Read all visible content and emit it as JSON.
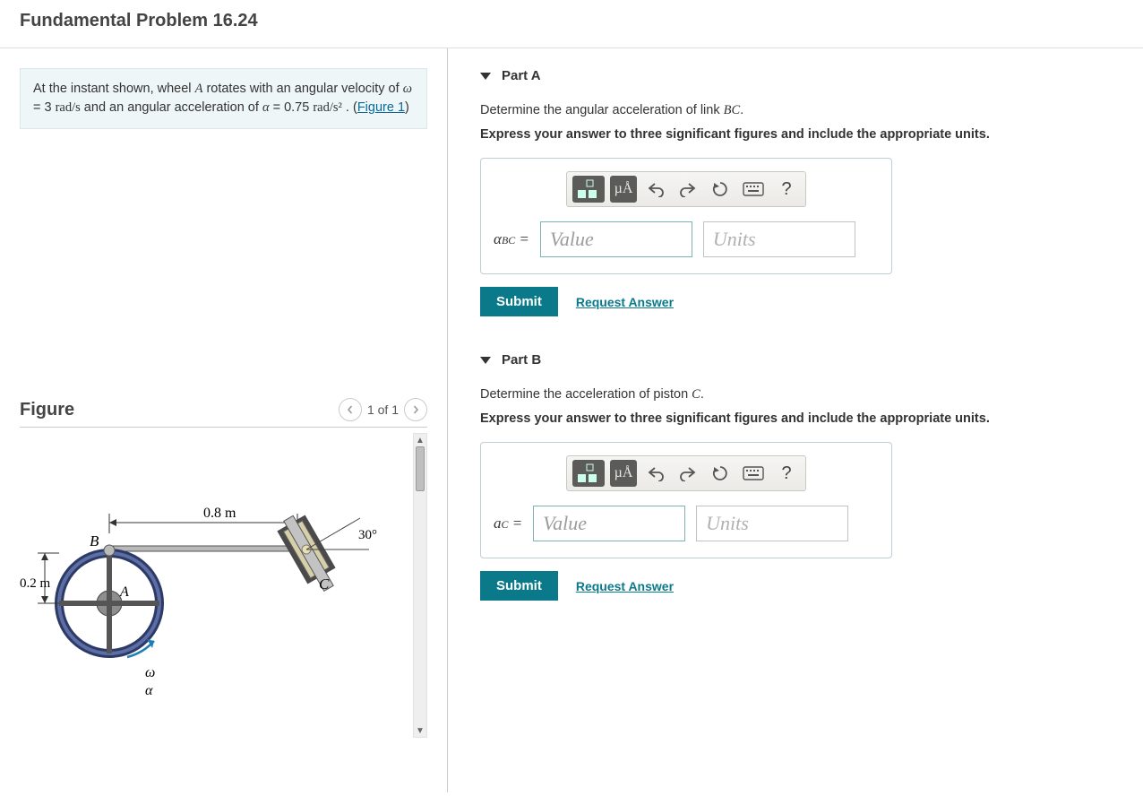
{
  "problem_title": "Fundamental Problem 16.24",
  "statement": {
    "s1": "At the instant shown, wheel ",
    "A": "A",
    "s2": " rotates with an angular velocity of ",
    "omega": "ω",
    "s3": " = 3 ",
    "unit_w": "rad/s",
    "s4": " and an angular acceleration of ",
    "alpha": "α",
    "s5": " = 0.75 ",
    "unit_a": "rad/s²",
    "s6": " . (",
    "figlink": "Figure 1",
    "s7": ")"
  },
  "figure": {
    "label": "Figure",
    "pager": "1 of 1",
    "dim_bc": "0.8 m",
    "dim_r": "0.2 m",
    "ang": "30°",
    "lbl_A": "A",
    "lbl_B": "B",
    "lbl_C": "C",
    "lbl_w": "ω",
    "lbl_al": "α"
  },
  "parts": [
    {
      "title": "Part A",
      "prompt_1": "Determine the angular acceleration of link ",
      "prompt_var": "BC",
      "prompt_2": ".",
      "instruction": "Express your answer to three significant figures and include the appropriate units.",
      "lhs_var": "α",
      "lhs_sub": "BC",
      "value_ph": "Value",
      "units_ph": "Units",
      "submit": "Submit",
      "request": "Request Answer",
      "toolbar": {
        "mu": "µÅ",
        "help": "?"
      }
    },
    {
      "title": "Part B",
      "prompt_1": "Determine the acceleration of piston ",
      "prompt_var": "C",
      "prompt_2": ".",
      "instruction": "Express your answer to three significant figures and include the appropriate units.",
      "lhs_var": "a",
      "lhs_sub": "C",
      "value_ph": "Value",
      "units_ph": "Units",
      "submit": "Submit",
      "request": "Request Answer",
      "toolbar": {
        "mu": "µÅ",
        "help": "?"
      }
    }
  ]
}
